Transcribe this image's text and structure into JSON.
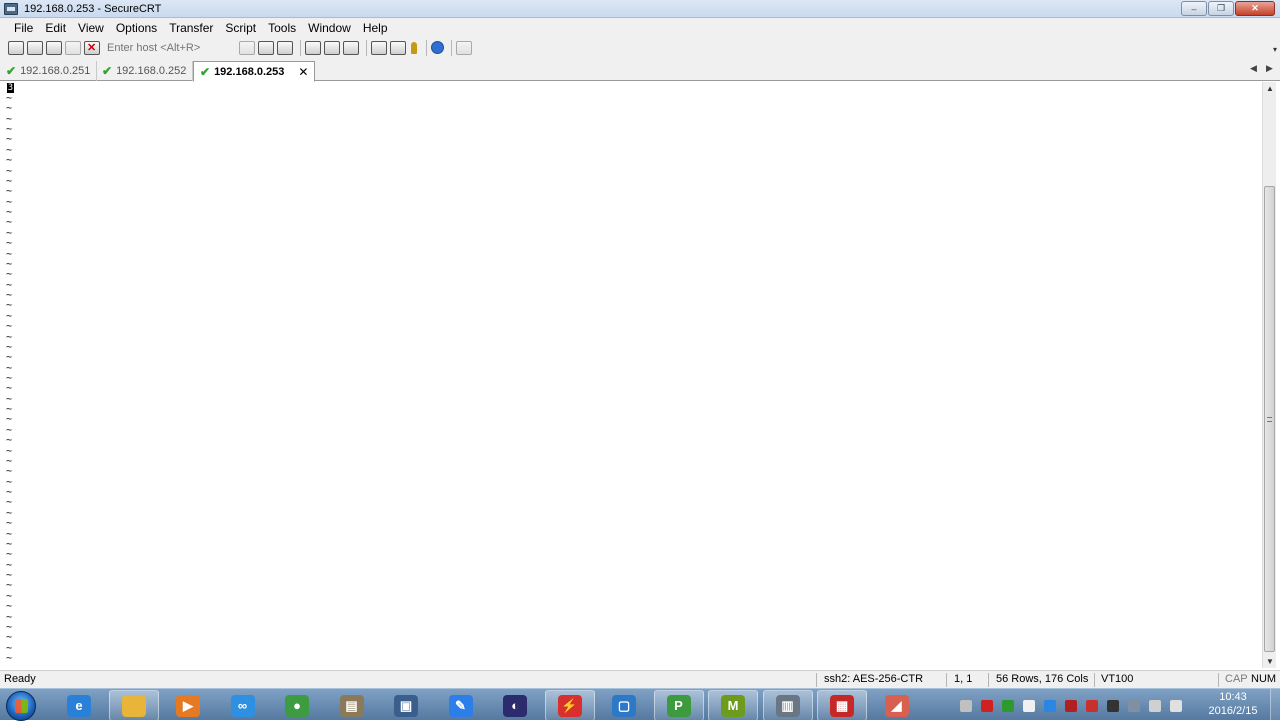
{
  "window": {
    "title": "192.168.0.253 - SecureCRT",
    "minimize_glyph": "‒",
    "maximize_glyph": "❐",
    "close_glyph": "✕"
  },
  "menu": {
    "items": [
      "File",
      "Edit",
      "View",
      "Options",
      "Transfer",
      "Script",
      "Tools",
      "Window",
      "Help"
    ]
  },
  "toolbar": {
    "host_placeholder": "Enter host <Alt+R>",
    "dropdown_glyph": "▾"
  },
  "tabs": [
    {
      "label": "192.168.0.251",
      "check": "✔",
      "active": false
    },
    {
      "label": "192.168.0.252",
      "check": "✔",
      "active": false
    },
    {
      "label": "192.168.0.253",
      "check": "✔",
      "active": true,
      "close": "✕"
    }
  ],
  "tab_nav": {
    "prev": "◀",
    "next": "▶"
  },
  "terminal": {
    "cursor_char": "3",
    "filler_char": "~",
    "filler_lines": 55
  },
  "scrollbar": {
    "up": "▲",
    "down": "▼"
  },
  "status": {
    "ready": "Ready",
    "cipher": "ssh2: AES-256-CTR",
    "cursor_pos": "1,   1",
    "dimensions": "56 Rows, 176 Cols",
    "emulation": "VT100",
    "caps": "CAP",
    "num": "NUM"
  },
  "taskbar": {
    "clock_time": "10:43",
    "clock_date": "2016/2/15",
    "apps": [
      {
        "name": "internet-explorer",
        "color": "#2a7fd6",
        "glyph": "e"
      },
      {
        "name": "file-explorer",
        "color": "#e8b53a",
        "glyph": ""
      },
      {
        "name": "media-player",
        "color": "#e67a22",
        "glyph": "▶"
      },
      {
        "name": "cloud-sync",
        "color": "#2f8fe0",
        "glyph": "∞"
      },
      {
        "name": "chrome",
        "color": "#3d9b42",
        "glyph": "●"
      },
      {
        "name": "folder-tool",
        "color": "#8a7a5a",
        "glyph": "▤"
      },
      {
        "name": "network-manager",
        "color": "#3a5f8c",
        "glyph": "▣"
      },
      {
        "name": "feather-app",
        "color": "#2c7ee8",
        "glyph": "✎"
      },
      {
        "name": "eclipse",
        "color": "#2b2b6e",
        "glyph": "◐"
      },
      {
        "name": "flash-app",
        "color": "#d8302c",
        "glyph": "⚡"
      },
      {
        "name": "virtualbox",
        "color": "#2d79c7",
        "glyph": "▢"
      },
      {
        "name": "project-app",
        "color": "#3e9a3e",
        "glyph": "P"
      },
      {
        "name": "m-app",
        "color": "#6d9b1e",
        "glyph": "M"
      },
      {
        "name": "securecrt",
        "color": "#6b7685",
        "glyph": "▥"
      },
      {
        "name": "pdf-reader",
        "color": "#c62828",
        "glyph": "▦"
      },
      {
        "name": "eraser-tool",
        "color": "#d86050",
        "glyph": "◢"
      }
    ],
    "tray": [
      "#c0c0c0",
      "#d02020",
      "#2e9a2e",
      "#f0f0f0",
      "#2a86e0",
      "#b02020",
      "#c83030",
      "#333333",
      "#8090a0",
      "#d0d0d0",
      "#e0e0e0"
    ]
  }
}
